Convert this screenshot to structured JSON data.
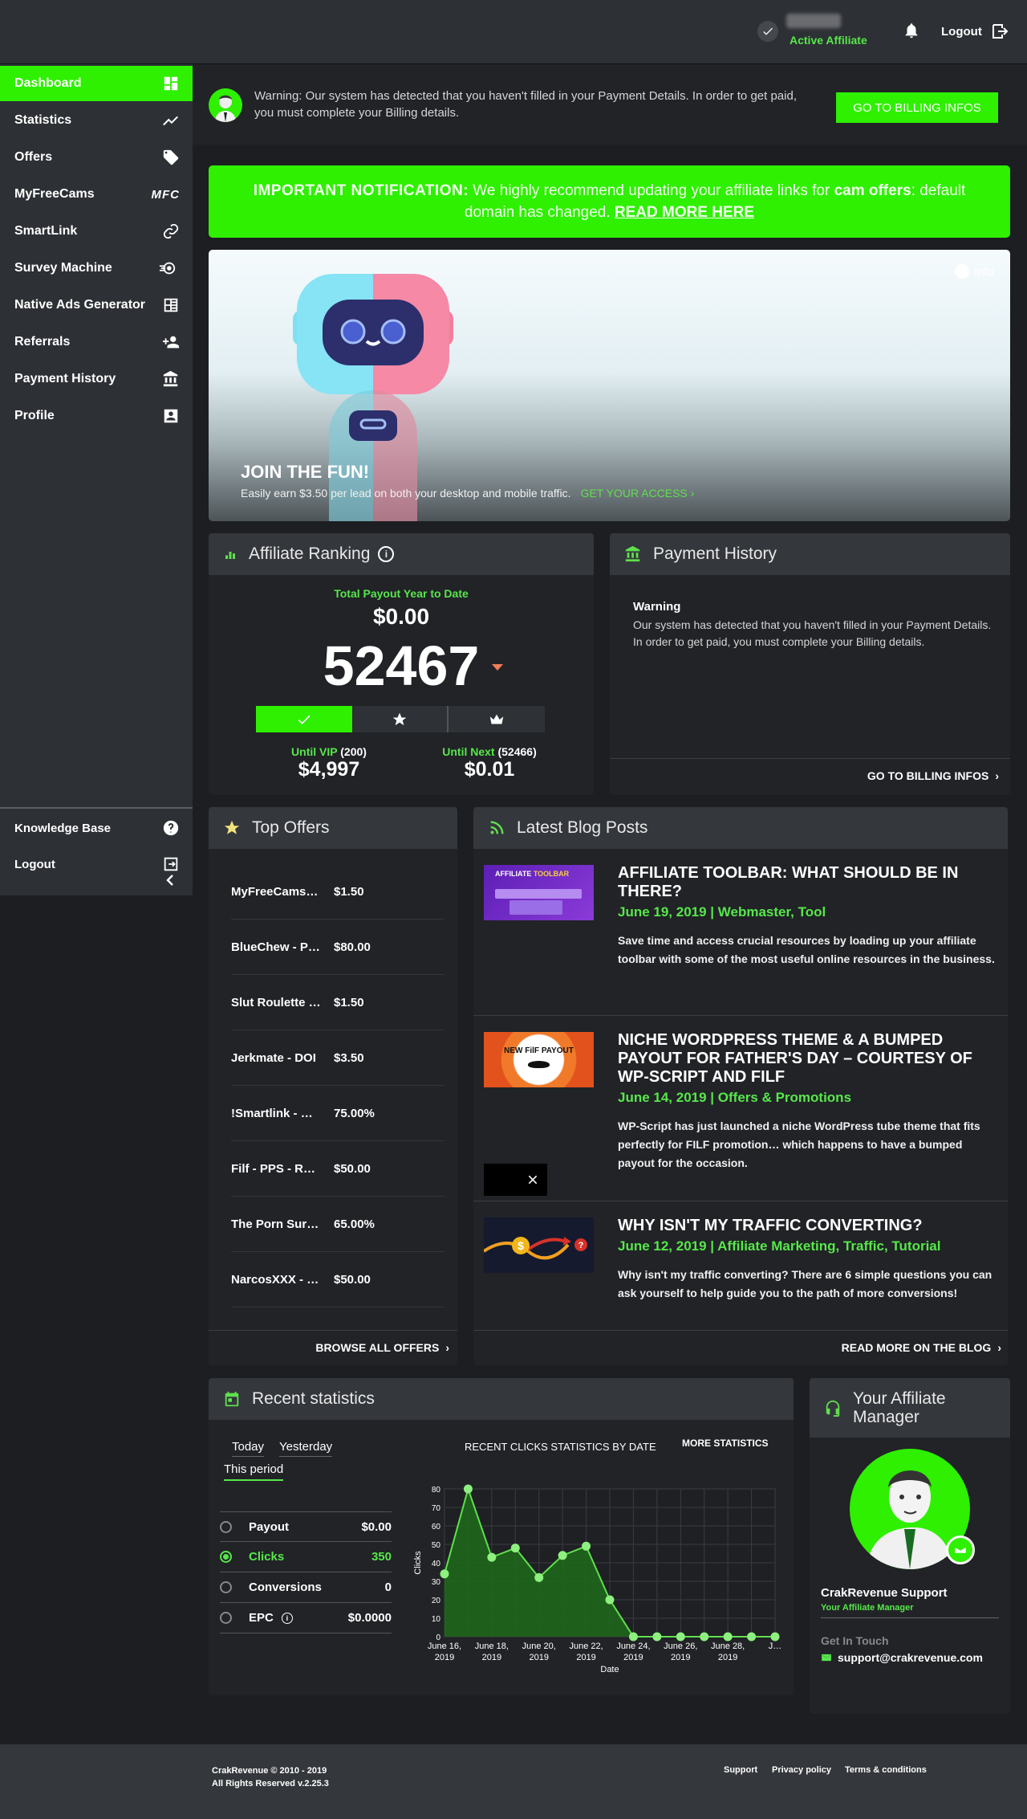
{
  "topbar": {
    "affiliate_status": "Active Affiliate",
    "logout_label": "Logout"
  },
  "sidebar": {
    "items": [
      {
        "label": "Dashboard",
        "icon": "dashboard-icon",
        "active": true
      },
      {
        "label": "Statistics",
        "icon": "trending-icon"
      },
      {
        "label": "Offers",
        "icon": "tag-icon"
      },
      {
        "label": "MyFreeCams",
        "icon": "mfc-logo"
      },
      {
        "label": "SmartLink",
        "icon": "link-icon"
      },
      {
        "label": "Survey Machine",
        "icon": "rocket-icon"
      },
      {
        "label": "Native Ads Generator",
        "icon": "ads-icon"
      },
      {
        "label": "Referrals",
        "icon": "add-users-icon"
      },
      {
        "label": "Payment History",
        "icon": "bank-icon"
      },
      {
        "label": "Profile",
        "icon": "profile-icon"
      }
    ],
    "mfc_text": "MFC",
    "bottom": [
      {
        "label": "Knowledge Base",
        "icon": "help-icon"
      },
      {
        "label": "Logout",
        "icon": "logout-icon"
      }
    ]
  },
  "warning": {
    "text": "Warning: Our system has detected that you haven't filled in your Payment Details. In order to get paid, you must complete your Billing details.",
    "button": "GO TO BILLING INFOS"
  },
  "notification": {
    "label": "IMPORTANT NOTIFICATION:",
    "text_a": " We highly recommend updating your affiliate links for ",
    "bold": "cam offers",
    "text_b": ": default domain has changed. ",
    "link": "READ MORE HERE"
  },
  "banner": {
    "info": "Info",
    "title": "JOIN THE FUN!",
    "text": "Easily earn $3.50 per lead on both your desktop and mobile traffic.",
    "cta": "GET YOUR ACCESS"
  },
  "ranking": {
    "title": "Affiliate Ranking",
    "payout_label": "Total Payout Year to Date",
    "payout": "$0.00",
    "rank": "52467",
    "vip_label": "Until VIP",
    "vip_count": "(200)",
    "vip_amount": "$4,997",
    "next_label": "Until Next",
    "next_count": "(52466)",
    "next_amount": "$0.01"
  },
  "payment_history": {
    "title": "Payment History",
    "warning_title": "Warning",
    "warning_text": "Our system has detected that you haven't filled in your Payment Details. In order to get paid, you must complete your Billing details.",
    "link": "GO TO BILLING INFOS"
  },
  "top_offers": {
    "title": "Top Offers",
    "items": [
      {
        "name": "MyFreeCams - PPS",
        "payout": "$1.50"
      },
      {
        "name": "BlueChew - PPS",
        "payout": "$80.00"
      },
      {
        "name": "Slut Roulette - PPS",
        "payout": "$1.50"
      },
      {
        "name": "Jerkmate - DOI",
        "payout": "$3.50"
      },
      {
        "name": "!Smartlink - Desktop",
        "payout": "75.00%"
      },
      {
        "name": "Filf - PPS - Revshare",
        "payout": "$50.00"
      },
      {
        "name": "The Porn Survey",
        "payout": "65.00%"
      },
      {
        "name": "NarcosXXX - PPS",
        "payout": "$50.00"
      }
    ],
    "link": "BROWSE ALL OFFERS"
  },
  "blog": {
    "title": "Latest Blog Posts",
    "posts": [
      {
        "title": "AFFILIATE TOOLBAR: WHAT SHOULD BE IN THERE?",
        "meta": "June 19, 2019 | Webmaster, Tool",
        "excerpt": "Save time and access crucial resources by loading up your affiliate toolbar with some of the most useful online resources in the business.",
        "thumb_text_a": "AFFILIATE",
        "thumb_text_b": "TOOLBAR"
      },
      {
        "title": "NICHE WORDPRESS THEME & A BUMPED PAYOUT FOR FATHER'S DAY – COURTESY OF WP-SCRIPT AND FILF",
        "meta": "June 14, 2019 | Offers & Promotions",
        "excerpt": "WP-Script has just launched a niche WordPress tube theme that fits perfectly for FILF promotion… which happens to have a bumped payout for the occasion.",
        "thumb_text": "NEW FilF PAYOUT"
      },
      {
        "title": "WHY ISN'T MY TRAFFIC CONVERTING?",
        "meta": "June 12, 2019 | Affiliate Marketing, Traffic, Tutorial",
        "excerpt": "Why isn't my traffic converting? There are 6 simple questions you can ask yourself to help guide you to the path of more conversions!"
      }
    ],
    "link": "READ MORE ON THE BLOG"
  },
  "recent_stats": {
    "title": "Recent statistics",
    "tabs": [
      "Today",
      "Yesterday",
      "This period"
    ],
    "rows": [
      {
        "label": "Payout",
        "value": "$0.00"
      },
      {
        "label": "Clicks",
        "value": "350",
        "selected": true
      },
      {
        "label": "Conversions",
        "value": "0"
      },
      {
        "label": "EPC",
        "value": "$0.0000"
      }
    ],
    "chart_title": "RECENT CLICKS STATISTICS BY DATE",
    "more": "MORE STATISTICS"
  },
  "chart_data": {
    "type": "area",
    "title": "RECENT CLICKS STATISTICS BY DATE",
    "xlabel": "Date",
    "ylabel": "Clicks",
    "x": [
      "June 16, 2019",
      "June 17, 2019",
      "June 18, 2019",
      "June 19, 2019",
      "June 20, 2019",
      "June 21, 2019",
      "June 22, 2019",
      "June 23, 2019",
      "June 24, 2019",
      "June 25, 2019",
      "June 26, 2019",
      "June 27, 2019",
      "June 28, 2019",
      "June 29, 2019",
      "June 30, 2019"
    ],
    "tick_labels": [
      [
        "June 16,",
        "2019"
      ],
      [
        "June 18,",
        "2019"
      ],
      [
        "June 20,",
        "2019"
      ],
      [
        "June 22,",
        "2019"
      ],
      [
        "June 24,",
        "2019"
      ],
      [
        "June 26,",
        "2019"
      ],
      [
        "June 28,",
        "2019"
      ],
      [
        "J…",
        ""
      ]
    ],
    "values": [
      34,
      80,
      43,
      48,
      32,
      44,
      49,
      20,
      0,
      0,
      0,
      0,
      0,
      0,
      0
    ],
    "ylim": [
      0,
      80
    ],
    "yticks": [
      0,
      10,
      20,
      30,
      40,
      50,
      60,
      70,
      80
    ],
    "grid": true,
    "color": "#5fe04c"
  },
  "manager": {
    "title": "Your Affiliate Manager",
    "name": "CrakRevenue Support",
    "role": "Your Affiliate Manager",
    "contact_label": "Get In Touch",
    "email": "support@crakrevenue.com"
  },
  "footer": {
    "copyright": "CrakRevenue © 2010 - 2019",
    "rights": "All Rights Reserved v.2.25.3",
    "links": [
      "Support",
      "Privacy policy",
      "Terms & conditions"
    ]
  }
}
